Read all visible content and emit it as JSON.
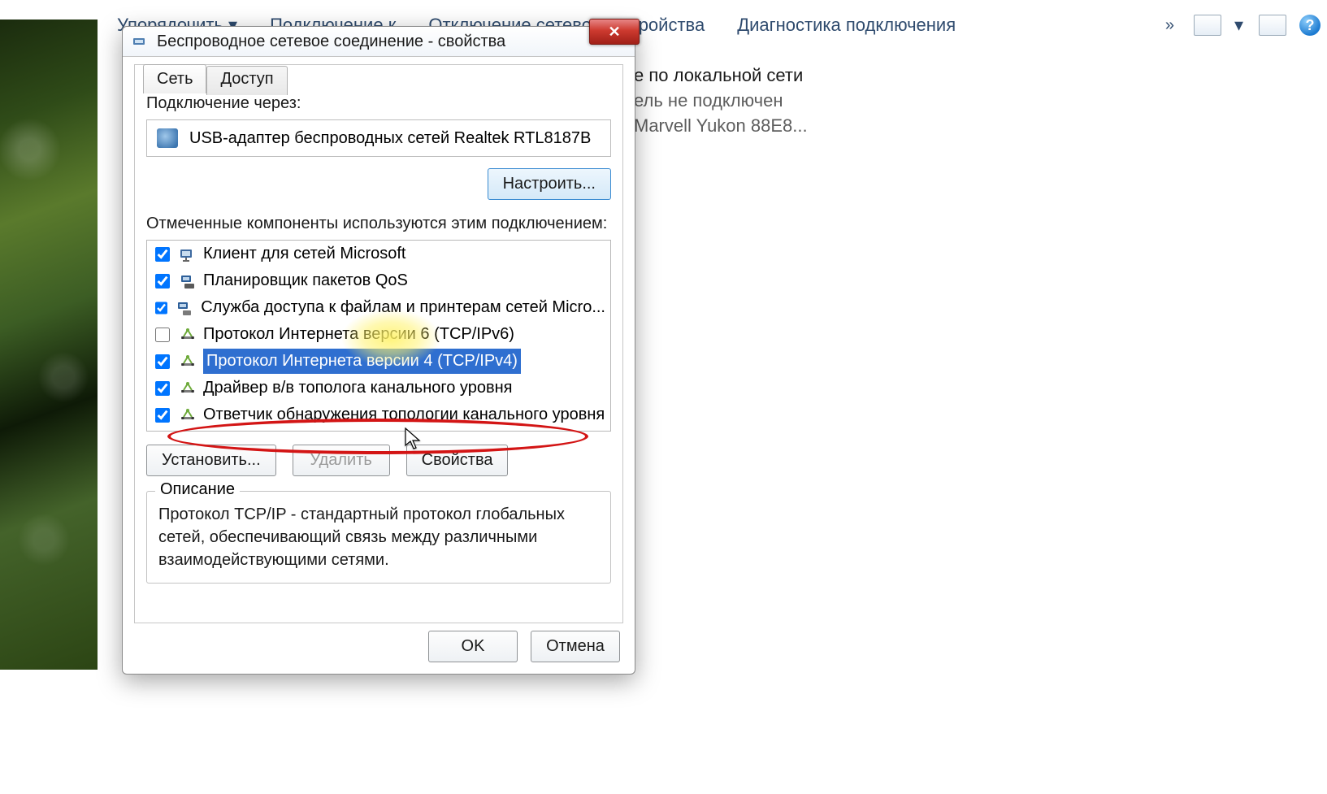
{
  "toolbar": {
    "items": [
      "Упорядочить ▾",
      "Подключение к",
      "Отключение сетевого устройства",
      "Диагностика подключения"
    ],
    "help_glyph": "?"
  },
  "lan": {
    "title_tail": "е по локальной сети",
    "line2_tail": "ель не подключен",
    "line3_tail": "Marvell Yukon 88E8..."
  },
  "dialog": {
    "title": "Беспроводное сетевое соединение - свойства",
    "close_glyph": "✕",
    "tabs": {
      "network": "Сеть",
      "access": "Доступ"
    },
    "connect_using_label": "Подключение через:",
    "adapter": "USB-адаптер беспроводных сетей Realtek RTL8187B",
    "configure": "Настроить...",
    "components_label": "Отмеченные компоненты используются этим подключением:",
    "components": [
      {
        "checked": true,
        "icon": "client",
        "text": "Клиент для сетей Microsoft",
        "selected": false
      },
      {
        "checked": true,
        "icon": "qos",
        "text": "Планировщик пакетов QoS",
        "selected": false
      },
      {
        "checked": true,
        "icon": "fshare",
        "text": "Служба доступа к файлам и принтерам сетей Micro...",
        "selected": false
      },
      {
        "checked": false,
        "icon": "proto",
        "text": "Протокол Интернета версии 6 (TCP/IPv6)",
        "selected": false
      },
      {
        "checked": true,
        "icon": "proto",
        "text": "Протокол Интернета версии 4 (TCP/IPv4)",
        "selected": true
      },
      {
        "checked": true,
        "icon": "proto",
        "text": "Драйвер в/в тополога канального уровня",
        "selected": false
      },
      {
        "checked": true,
        "icon": "proto",
        "text": "Ответчик обнаружения топологии канального уровня",
        "selected": false
      }
    ],
    "install": "Установить...",
    "uninstall": "Удалить",
    "properties": "Свойства",
    "description_label": "Описание",
    "description": "Протокол TCP/IP - стандартный протокол глобальных сетей, обеспечивающий связь между различными взаимодействующими сетями.",
    "ok": "OK",
    "cancel": "Отмена"
  }
}
